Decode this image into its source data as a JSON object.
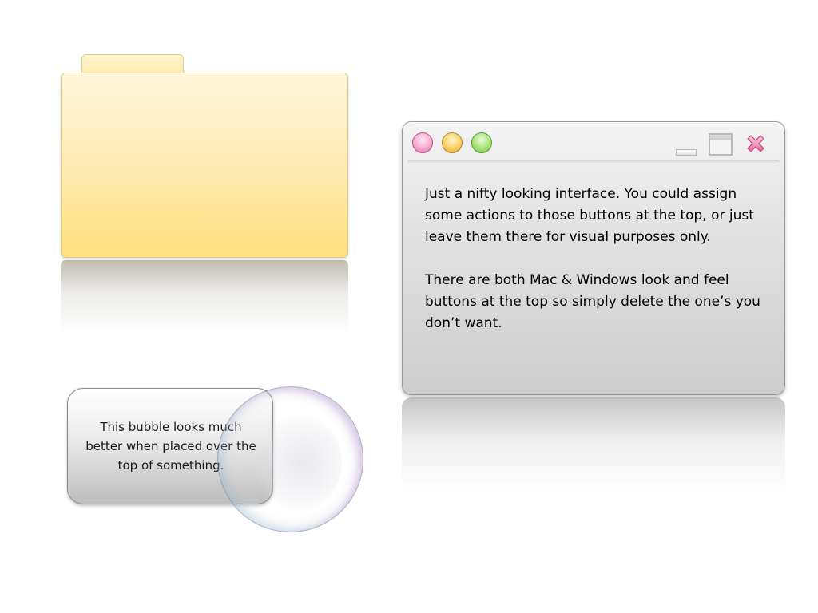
{
  "slide": {
    "window": {
      "traffic_lights": [
        {
          "icon": "close-traffic-light-icon",
          "color": "#f7a8cf"
        },
        {
          "icon": "minimize-traffic-light-icon",
          "color": "#fbd067"
        },
        {
          "icon": "zoom-traffic-light-icon",
          "color": "#a7e27a"
        }
      ],
      "windows_controls": [
        "minimize-icon",
        "maximize-icon",
        "close-x-icon"
      ],
      "paragraph_1": "Just a nifty looking interface. You could assign some actions to those buttons at the top, or just leave them there for visual purposes only.",
      "paragraph_2": "There are both Mac & Windows look and feel buttons at the top so simply delete the one’s you don’t want."
    },
    "bubble": {
      "text": "This bubble looks much better when placed over the top of something."
    },
    "colors": {
      "folder": "#fde07c",
      "window": "#e2e2e2",
      "close_x": "#e4679f"
    }
  }
}
